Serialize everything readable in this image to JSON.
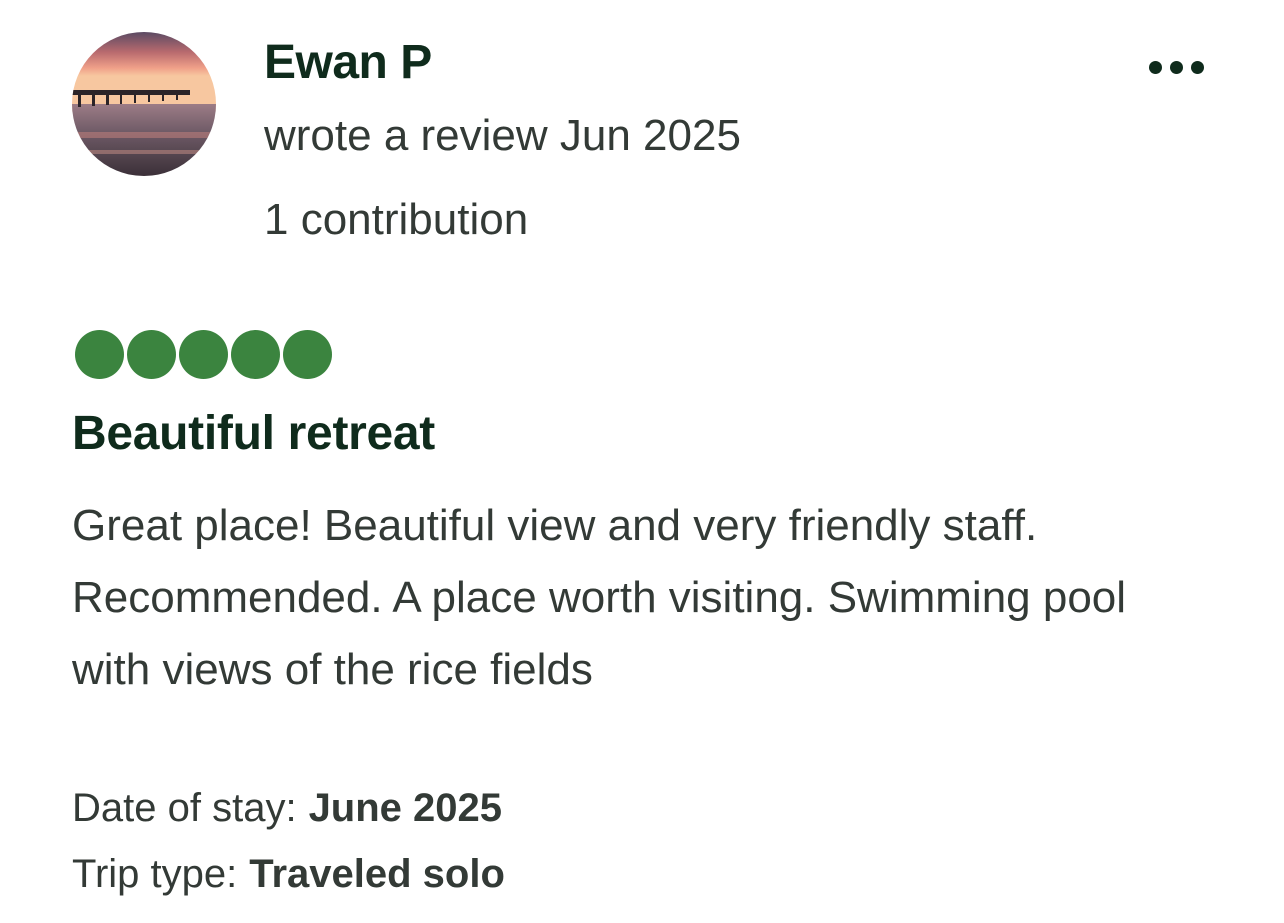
{
  "review": {
    "user": {
      "name": "Ewan P",
      "meta": "wrote a review Jun 2025",
      "contributions": "1 contribution",
      "avatar_icon": "pier-sunset-photo"
    },
    "more_icon": "more-options-icon",
    "rating": {
      "value": 5,
      "max": 5,
      "bubble_color": "#3b843f"
    },
    "title": "Beautiful retreat",
    "body": "Great place! Beautiful view and very friendly staff. Recommended. A place worth visiting. Swimming pool with views of the rice fields",
    "details": {
      "date_of_stay_label": "Date of stay:",
      "date_of_stay_value": "June 2025",
      "trip_type_label": "Trip type:",
      "trip_type_value": "Traveled solo"
    }
  }
}
